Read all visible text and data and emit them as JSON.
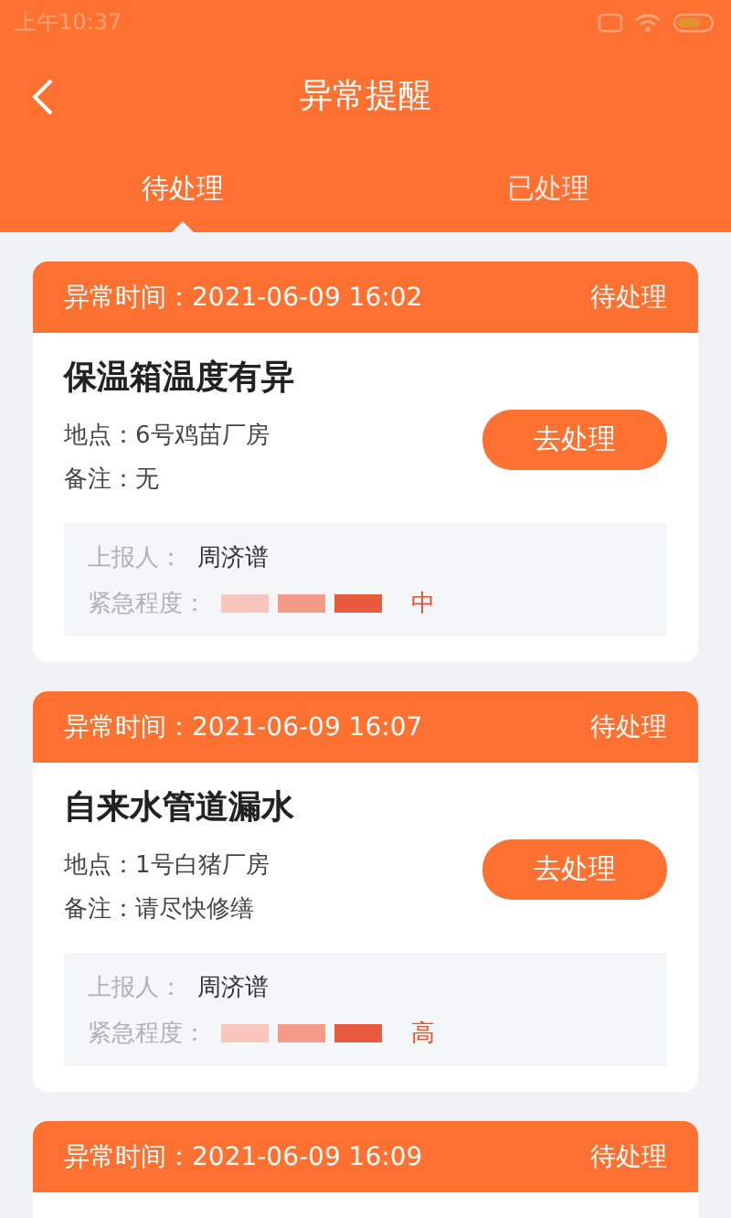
{
  "status_bar": {
    "time": "上午10:37"
  },
  "header": {
    "title": "异常提醒"
  },
  "tabs": [
    {
      "label": "待处理",
      "selected": true
    },
    {
      "label": "已处理",
      "selected": false
    }
  ],
  "cards": [
    {
      "time": "异常时间：2021-06-09 16:02",
      "status": "待处理",
      "title": "保温箱温度有异",
      "location_label": "地点：",
      "location": "6号鸡苗厂房",
      "note_label": "备注：",
      "note": "无",
      "action": "去处理",
      "reporter_label": "上报人：",
      "reporter": "周济谱",
      "urgency_label": "紧急程度：",
      "urgency": "中"
    },
    {
      "time": "异常时间：2021-06-09 16:07",
      "status": "待处理",
      "title": "自来水管道漏水",
      "location_label": "地点：",
      "location": "1号白猪厂房",
      "note_label": "备注：",
      "note": "请尽快修缮",
      "action": "去处理",
      "reporter_label": "上报人：",
      "reporter": "周济谱",
      "urgency_label": "紧急程度：",
      "urgency": "高"
    },
    {
      "time": "异常时间：2021-06-09 16:09",
      "status": "待处理"
    }
  ]
}
